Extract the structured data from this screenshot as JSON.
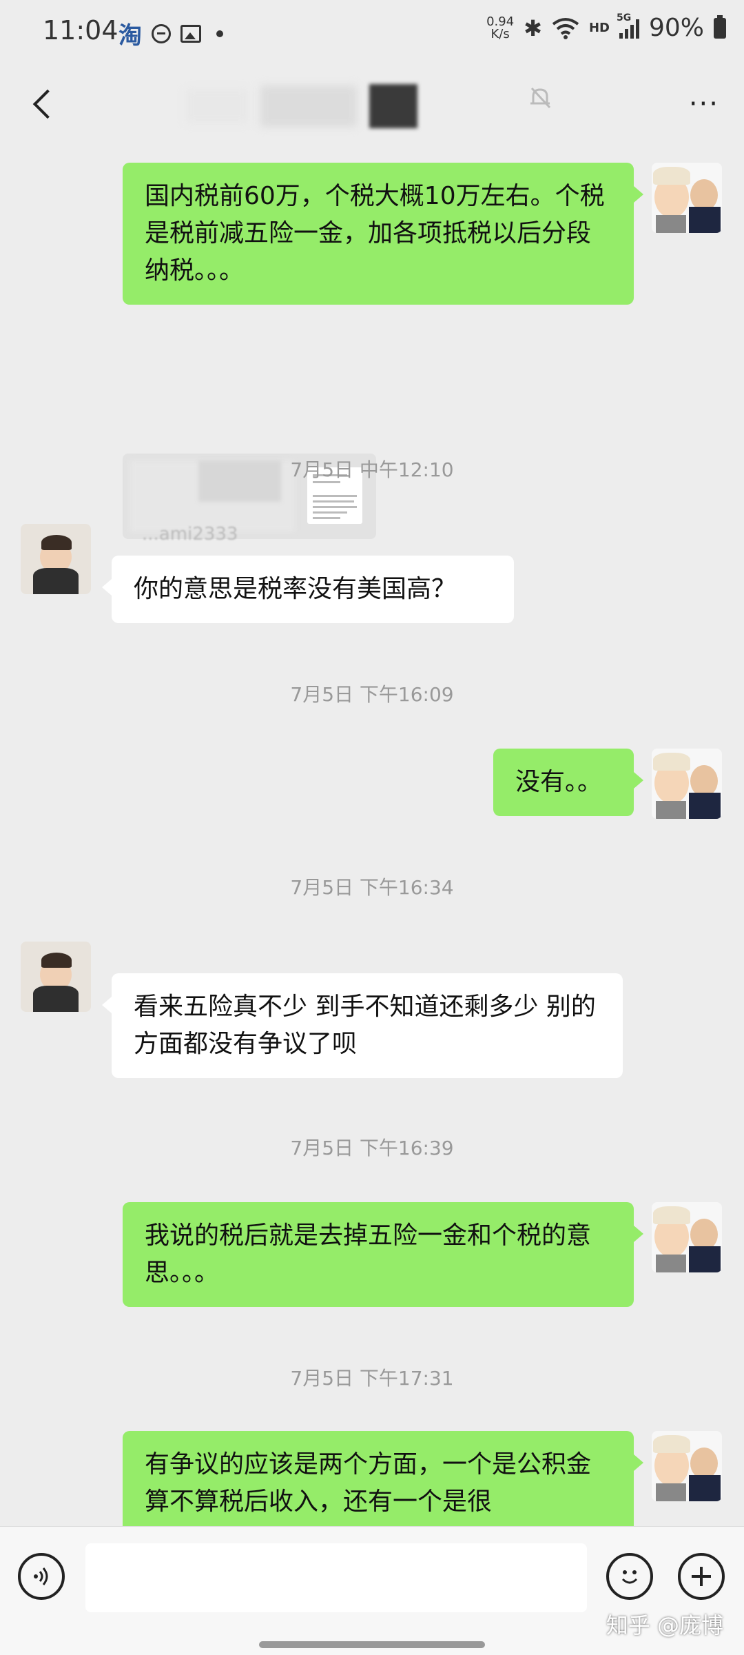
{
  "status_bar": {
    "time": "11:04",
    "taobao_icon": "淘",
    "net_speed_value": "0.94",
    "net_speed_unit": "K/s",
    "network_label": "HD",
    "signal_label": "5G",
    "battery": "90%"
  },
  "header": {
    "more_label": "···"
  },
  "messages": [
    {
      "type": "text",
      "from": "me",
      "text": "国内税前60万，个税大概10万左右。个税是税前减五险一金，加各项抵税以后分段纳税。。。"
    },
    {
      "type": "image",
      "from": "me"
    },
    {
      "type": "time",
      "text": "7月5日 中午12:10"
    },
    {
      "type": "text",
      "from": "other",
      "sender": "...ami2333",
      "text": "你的意思是税率没有美国高？"
    },
    {
      "type": "time",
      "text": "7月5日 下午16:09"
    },
    {
      "type": "text",
      "from": "me",
      "text": "没有。。"
    },
    {
      "type": "time",
      "text": "7月5日 下午16:34"
    },
    {
      "type": "text",
      "from": "other",
      "text": "看来五险真不少 到手不知道还剩多少 别的方面都没有争议了呗"
    },
    {
      "type": "time",
      "text": "7月5日 下午16:39"
    },
    {
      "type": "text",
      "from": "me",
      "text": "我说的税后就是去掉五险一金和个税的意思。。。"
    },
    {
      "type": "time",
      "text": "7月5日 下午17:31"
    },
    {
      "type": "text",
      "from": "me",
      "text": "有争议的应该是两个方面，一个是公积金算不算税后收入，还有一个是很"
    }
  ],
  "input": {
    "placeholder": ""
  },
  "bottom": {
    "voice_icon": "voice-icon",
    "emoji_icon": "emoji-icon",
    "plus_icon": "plus-icon",
    "watermark": "知乎 @庞博"
  },
  "colors": {
    "background": "#ededed",
    "bubble_me": "#95ec69",
    "bubble_other": "#ffffff",
    "timestamp": "#999999"
  }
}
